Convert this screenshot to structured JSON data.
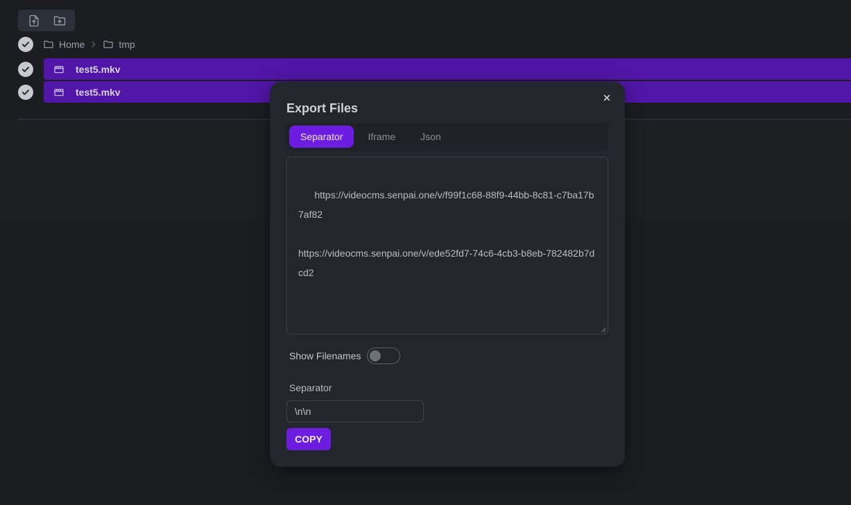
{
  "toolbar": {
    "upload_icon": "file-upload-icon",
    "new_folder_icon": "folder-plus-icon"
  },
  "breadcrumb": {
    "items": [
      {
        "label": "Home",
        "icon": "folder-icon"
      },
      {
        "label": "tmp",
        "icon": "folder-icon"
      }
    ],
    "separator_icon": "chevron-right-icon"
  },
  "files": [
    {
      "name": "test5.mkv",
      "icon": "film-icon",
      "selected": true
    },
    {
      "name": "test5.mkv",
      "icon": "film-icon",
      "selected": true
    }
  ],
  "modal": {
    "title": "Export Files",
    "close_icon": "close-icon",
    "tabs": [
      {
        "label": "Separator",
        "active": true
      },
      {
        "label": "Iframe",
        "active": false
      },
      {
        "label": "Json",
        "active": false
      }
    ],
    "output_text": "https://videocms.senpai.one/v/f99f1c68-88f9-44bb-8c81-c7ba17b7af82\n\nhttps://videocms.senpai.one/v/ede52fd7-74c6-4cb3-b8eb-782482b7dcd2",
    "show_filenames_label": "Show Filenames",
    "show_filenames_on": false,
    "separator_label": "Separator",
    "separator_value": "\\n\\n",
    "copy_label": "COPY"
  },
  "colors": {
    "accent": "#6c1de0",
    "selected_row": "#5116a8",
    "background": "#1b1d21",
    "modal_bg": "#23262d"
  }
}
